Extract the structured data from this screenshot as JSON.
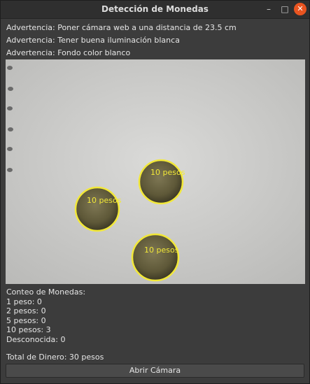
{
  "window": {
    "title": "Detección de Monedas",
    "controls": {
      "minimize": "–",
      "maximize": "□",
      "close": "✕"
    }
  },
  "warnings": [
    "Advertencia: Poner cámara web a una distancia de 23.5 cm",
    "Advertencia: Tener buena iluminación blanca",
    "Advertencia: Fondo color blanco"
  ],
  "camera_view": {
    "detections": [
      {
        "label": "10 pesos"
      },
      {
        "label": "10 pesos"
      },
      {
        "label": "10 pesos"
      }
    ],
    "circle_color": "#f2e838"
  },
  "counts": {
    "heading": "Conteo de Monedas:",
    "items": [
      "1 peso: 0",
      "2 pesos: 0",
      "5 pesos: 0",
      "10 pesos: 3",
      "Desconocida: 0"
    ]
  },
  "total": "Total de Dinero: 30 pesos",
  "button": {
    "open_camera": "Abrir Cámara"
  },
  "colors": {
    "window_bg": "#3c3c3c",
    "titlebar_bg": "#2f2f2f",
    "close_button": "#e95420",
    "text": "#e6e6e6"
  }
}
